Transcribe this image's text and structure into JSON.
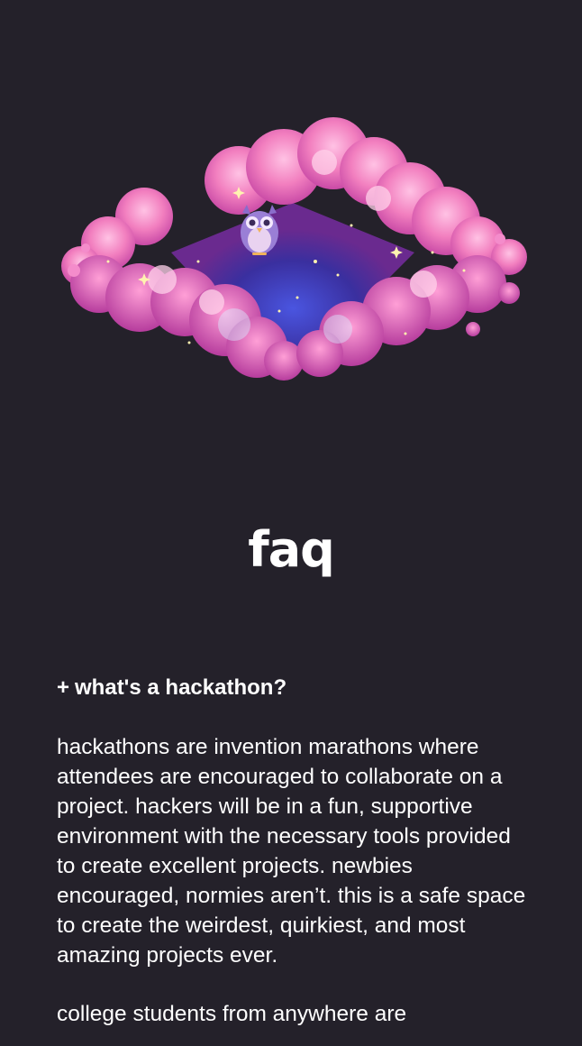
{
  "hero": {
    "icon": "moon-cloud-owl-illustration",
    "colors": {
      "background": "#24212a",
      "moon": "#fbe99a",
      "cloud_pink": "#f27fbf",
      "cloud_magenta": "#d94fb0",
      "sky_blue": "#3a3fbf",
      "owl": "#9a7fd6"
    }
  },
  "page": {
    "title": "faq"
  },
  "faq": {
    "items": [
      {
        "toggle": "+",
        "question": "what's a hackathon?",
        "answer": "hackathons are invention marathons where attendees are encouraged to collaborate on a project. hackers will be in a fun, supportive environment with the necessary tools provided to create excellent projects. newbies encouraged, normies aren’t. this is a safe space to create the weirdest, quirkiest, and most amazing projects ever.",
        "answer_continued": "college students from anywhere are"
      }
    ]
  }
}
